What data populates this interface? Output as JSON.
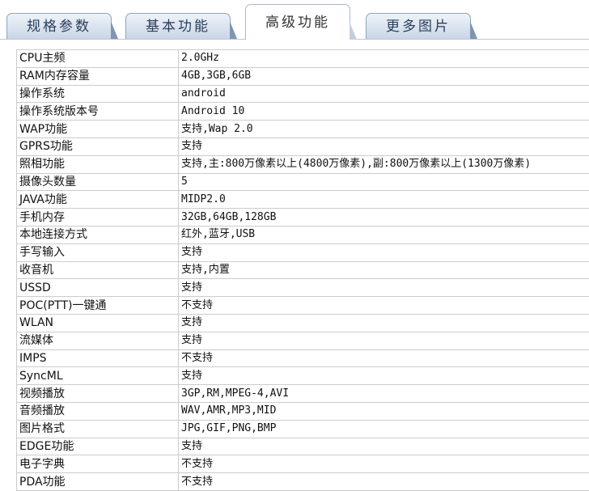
{
  "tabs": [
    {
      "label": "规格参数",
      "active": false
    },
    {
      "label": "基本功能",
      "active": false
    },
    {
      "label": "高级功能",
      "active": true
    },
    {
      "label": "更多图片",
      "active": false
    }
  ],
  "specs": [
    {
      "key": "CPU主频",
      "value": "2.0GHz"
    },
    {
      "key": "RAM内存容量",
      "value": "4GB,3GB,6GB"
    },
    {
      "key": "操作系统",
      "value": "android"
    },
    {
      "key": "操作系统版本号",
      "value": "Android 10"
    },
    {
      "key": "WAP功能",
      "value": "支持,Wap 2.0"
    },
    {
      "key": "GPRS功能",
      "value": "支持"
    },
    {
      "key": "照相功能",
      "value": "支持,主:800万像素以上(4800万像素),副:800万像素以上(1300万像素)"
    },
    {
      "key": "摄像头数量",
      "value": "5"
    },
    {
      "key": "JAVA功能",
      "value": "MIDP2.0"
    },
    {
      "key": "手机内存",
      "value": "32GB,64GB,128GB"
    },
    {
      "key": "本地连接方式",
      "value": "红外,蓝牙,USB"
    },
    {
      "key": "手写输入",
      "value": "支持"
    },
    {
      "key": "收音机",
      "value": "支持,内置"
    },
    {
      "key": "USSD",
      "value": "支持"
    },
    {
      "key": "POC(PTT)一键通",
      "value": "不支持"
    },
    {
      "key": "WLAN",
      "value": "支持"
    },
    {
      "key": "流媒体",
      "value": "支持"
    },
    {
      "key": "IMPS",
      "value": "不支持"
    },
    {
      "key": "SyncML",
      "value": "支持"
    },
    {
      "key": "视频播放",
      "value": "3GP,RM,MPEG-4,AVI"
    },
    {
      "key": "音频播放",
      "value": "WAV,AMR,MP3,MID"
    },
    {
      "key": "图片格式",
      "value": "JPG,GIF,PNG,BMP"
    },
    {
      "key": "EDGE功能",
      "value": "支持"
    },
    {
      "key": "电子字典",
      "value": "不支持"
    },
    {
      "key": "PDA功能",
      "value": "不支持"
    }
  ]
}
